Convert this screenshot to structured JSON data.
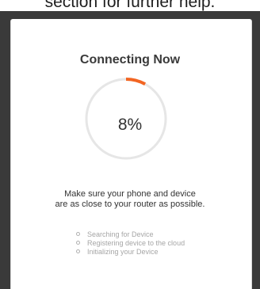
{
  "background": {
    "partial_text": "section for further help."
  },
  "dialog": {
    "title": "Connecting Now",
    "progress_label": "8%",
    "progress_fraction": 0.08,
    "accent_color": "#f26522",
    "track_color": "#e6e6e6",
    "message_lines": [
      "Make sure your phone and device",
      "are as close to your router as possible."
    ],
    "steps": [
      {
        "label": "Searching for Device"
      },
      {
        "label": "Registering device to the cloud"
      },
      {
        "label": "Initializing your Device"
      }
    ]
  }
}
